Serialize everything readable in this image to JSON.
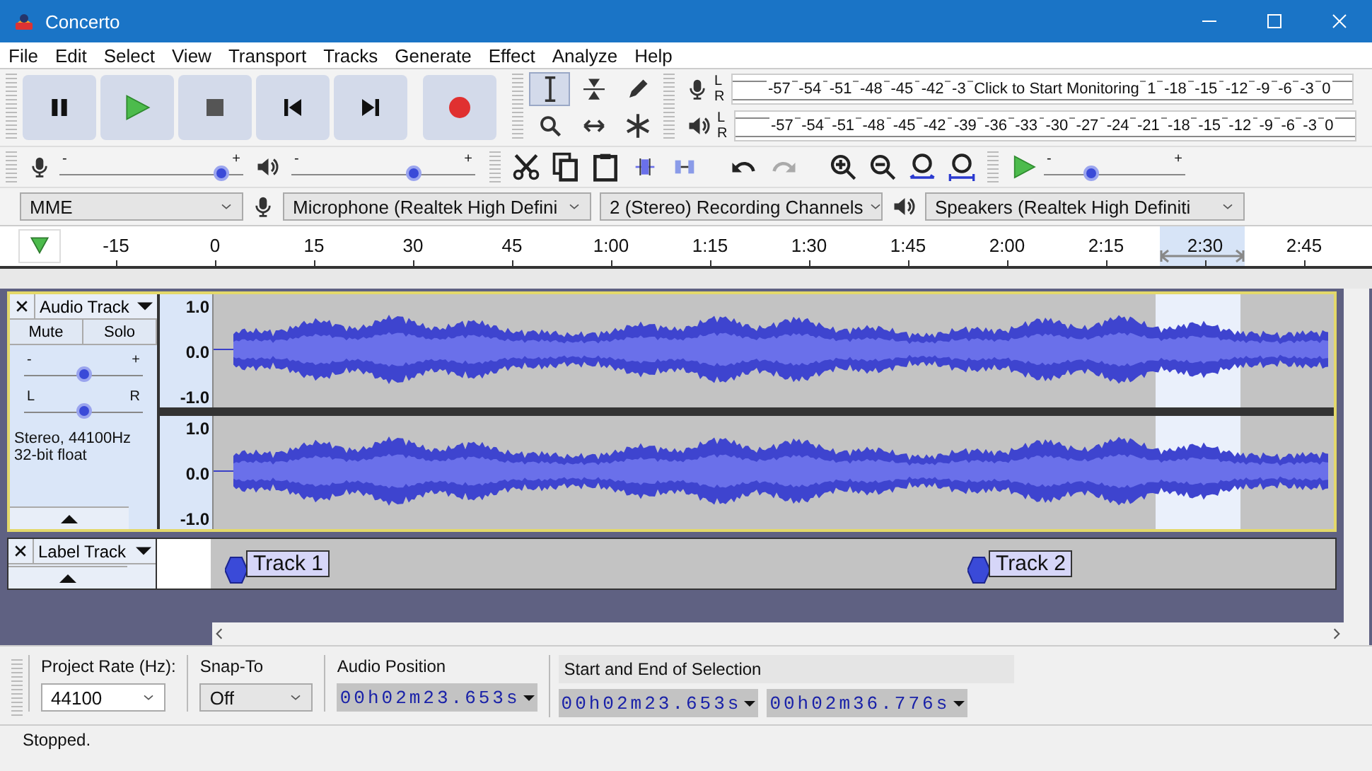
{
  "window": {
    "title": "Concerto"
  },
  "menu": [
    "File",
    "Edit",
    "Select",
    "View",
    "Transport",
    "Tracks",
    "Generate",
    "Effect",
    "Analyze",
    "Help"
  ],
  "tools": [
    {
      "kind": "select",
      "selected": true
    },
    {
      "kind": "envelope",
      "selected": false
    },
    {
      "kind": "draw",
      "selected": false
    },
    {
      "kind": "zoom",
      "selected": false
    },
    {
      "kind": "timeshift",
      "selected": false
    },
    {
      "kind": "multi",
      "selected": false
    }
  ],
  "meters": [
    {
      "kind": "record",
      "channels": [
        "L",
        "R"
      ],
      "scale_before": [
        "-57",
        "-54",
        "-51",
        "-48",
        "-45",
        "-42",
        "-3"
      ],
      "prompt": "Click to Start Monitoring",
      "scale_after": [
        "1",
        "-18",
        "-15",
        "-12",
        "-9",
        "-6",
        "-3",
        "0"
      ]
    },
    {
      "kind": "playback",
      "channels": [
        "L",
        "R"
      ],
      "scale_before": [
        "-57",
        "-54",
        "-51",
        "-48",
        "-45",
        "-42",
        "-39",
        "-36",
        "-33",
        "-30",
        "-27",
        "-24",
        "-21",
        "-18",
        "-15",
        "-12",
        "-9",
        "-6",
        "-3",
        "0"
      ]
    }
  ],
  "recording_volume": {
    "min_label": "-",
    "max_label": "+",
    "level": 0.88
  },
  "playback_volume": {
    "min_label": "-",
    "max_label": "+",
    "level": 0.66
  },
  "play_at_speed": {
    "min_label": "-",
    "max_label": "+",
    "level": 0.33
  },
  "devices": {
    "host": "MME",
    "microphone": "Microphone (Realtek High Defini",
    "channels": "2 (Stereo) Recording Channels",
    "speakers": "Speakers (Realtek High Definiti"
  },
  "timeline": {
    "ticks": [
      "-15",
      "0",
      "15",
      "30",
      "45",
      "1:00",
      "1:15",
      "1:30",
      "1:45",
      "2:00",
      "2:15",
      "2:30",
      "2:45"
    ]
  },
  "audio_track": {
    "name": "Audio Track",
    "mute": "Mute",
    "solo": "Solo",
    "gain": {
      "min_label": "-",
      "max_label": "+",
      "level": 0.5
    },
    "pan": {
      "min_label": "L",
      "max_label": "R",
      "level": 0.5
    },
    "info": [
      "Stereo, 44100Hz",
      "32-bit float"
    ],
    "channels": [
      {
        "scale": [
          "1.0",
          "0.0",
          "-1.0"
        ]
      },
      {
        "scale": [
          "1.0",
          "0.0",
          "-1.0"
        ]
      }
    ]
  },
  "label_track": {
    "name": "Label Track",
    "labels": [
      "Track 1",
      "Track 2"
    ]
  },
  "selection_toolbar": {
    "project_rate_label": "Project Rate (Hz):",
    "project_rate": "44100",
    "snap_to_label": "Snap-To",
    "snap_to": "Off",
    "audio_position_label": "Audio Position",
    "audio_position": "00h02m23.653s",
    "selection_label": "Start and End of Selection",
    "selection_start": "00h02m23.653s",
    "selection_end": "00h02m36.776s"
  },
  "status_bar": {
    "text": "Stopped."
  }
}
